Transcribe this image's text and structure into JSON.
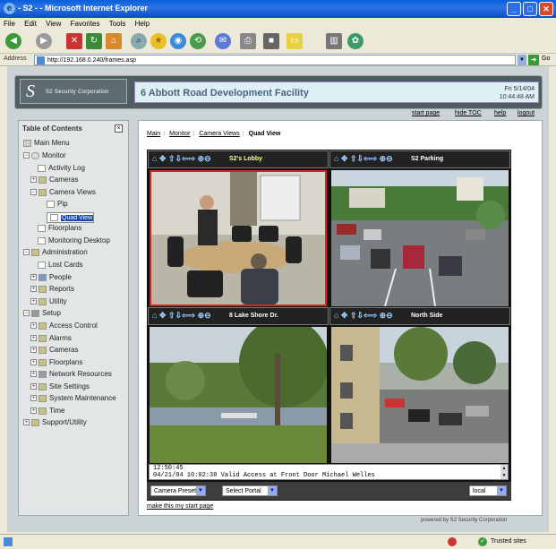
{
  "window": {
    "title": "- S2 - - Microsoft Internet Explorer"
  },
  "menu": [
    "File",
    "Edit",
    "View",
    "Favorites",
    "Tools",
    "Help"
  ],
  "address": {
    "label": "Address",
    "url": "http://192.168.0.240/frames.asp",
    "go": "Go"
  },
  "header": {
    "logo_letter": "S",
    "logo_text": "S2 Security Corporation",
    "facility": "6 Abbott Road Development Facility",
    "date": "Fri 5/14/04",
    "time": "10:44:48 AM"
  },
  "nav": {
    "start_page": "start page",
    "hide_toc": "hide TOC",
    "help": "help",
    "logout": "logout"
  },
  "toc": {
    "title": "Table of Contents",
    "close": "×",
    "items": [
      "Main Menu",
      "Monitor",
      "Activity Log",
      "Cameras",
      "Camera Views",
      "Pip",
      "Quad View",
      "Floorplans",
      "Monitoring Desktop",
      "Administration",
      "Lost Cards",
      "People",
      "Reports",
      "Utility",
      "Setup",
      "Access Control",
      "Alarms",
      "Cameras",
      "Floorplans",
      "Network Resources",
      "Site Settings",
      "System Maintenance",
      "Time",
      "Support/Utility"
    ]
  },
  "breadcrumb": {
    "main": "Main",
    "monitor": "Monitor",
    "camera_views": "Camera Views",
    "current": "Quad View",
    "sep": ":"
  },
  "cameras": [
    {
      "name": "S2's Lobby"
    },
    {
      "name": "S2 Parking"
    },
    {
      "name": "8 Lake Shore Dr."
    },
    {
      "name": "North Side"
    }
  ],
  "camera_controls": "⌂ ✥ ⇧⇩⇦⇨ ⊕⊖",
  "log": {
    "line1": "12:50:45",
    "line2": "04/21/04 10:02:38 Valid Access at Front Door Michael Welles"
  },
  "controls": {
    "camera_preset": "Camera Preset",
    "select_portal": "Select Portal",
    "scope": "local"
  },
  "start_link": "make this my start page",
  "powered": "powered by S2 Security Corporation",
  "status": {
    "zone": "Trusted sites"
  }
}
